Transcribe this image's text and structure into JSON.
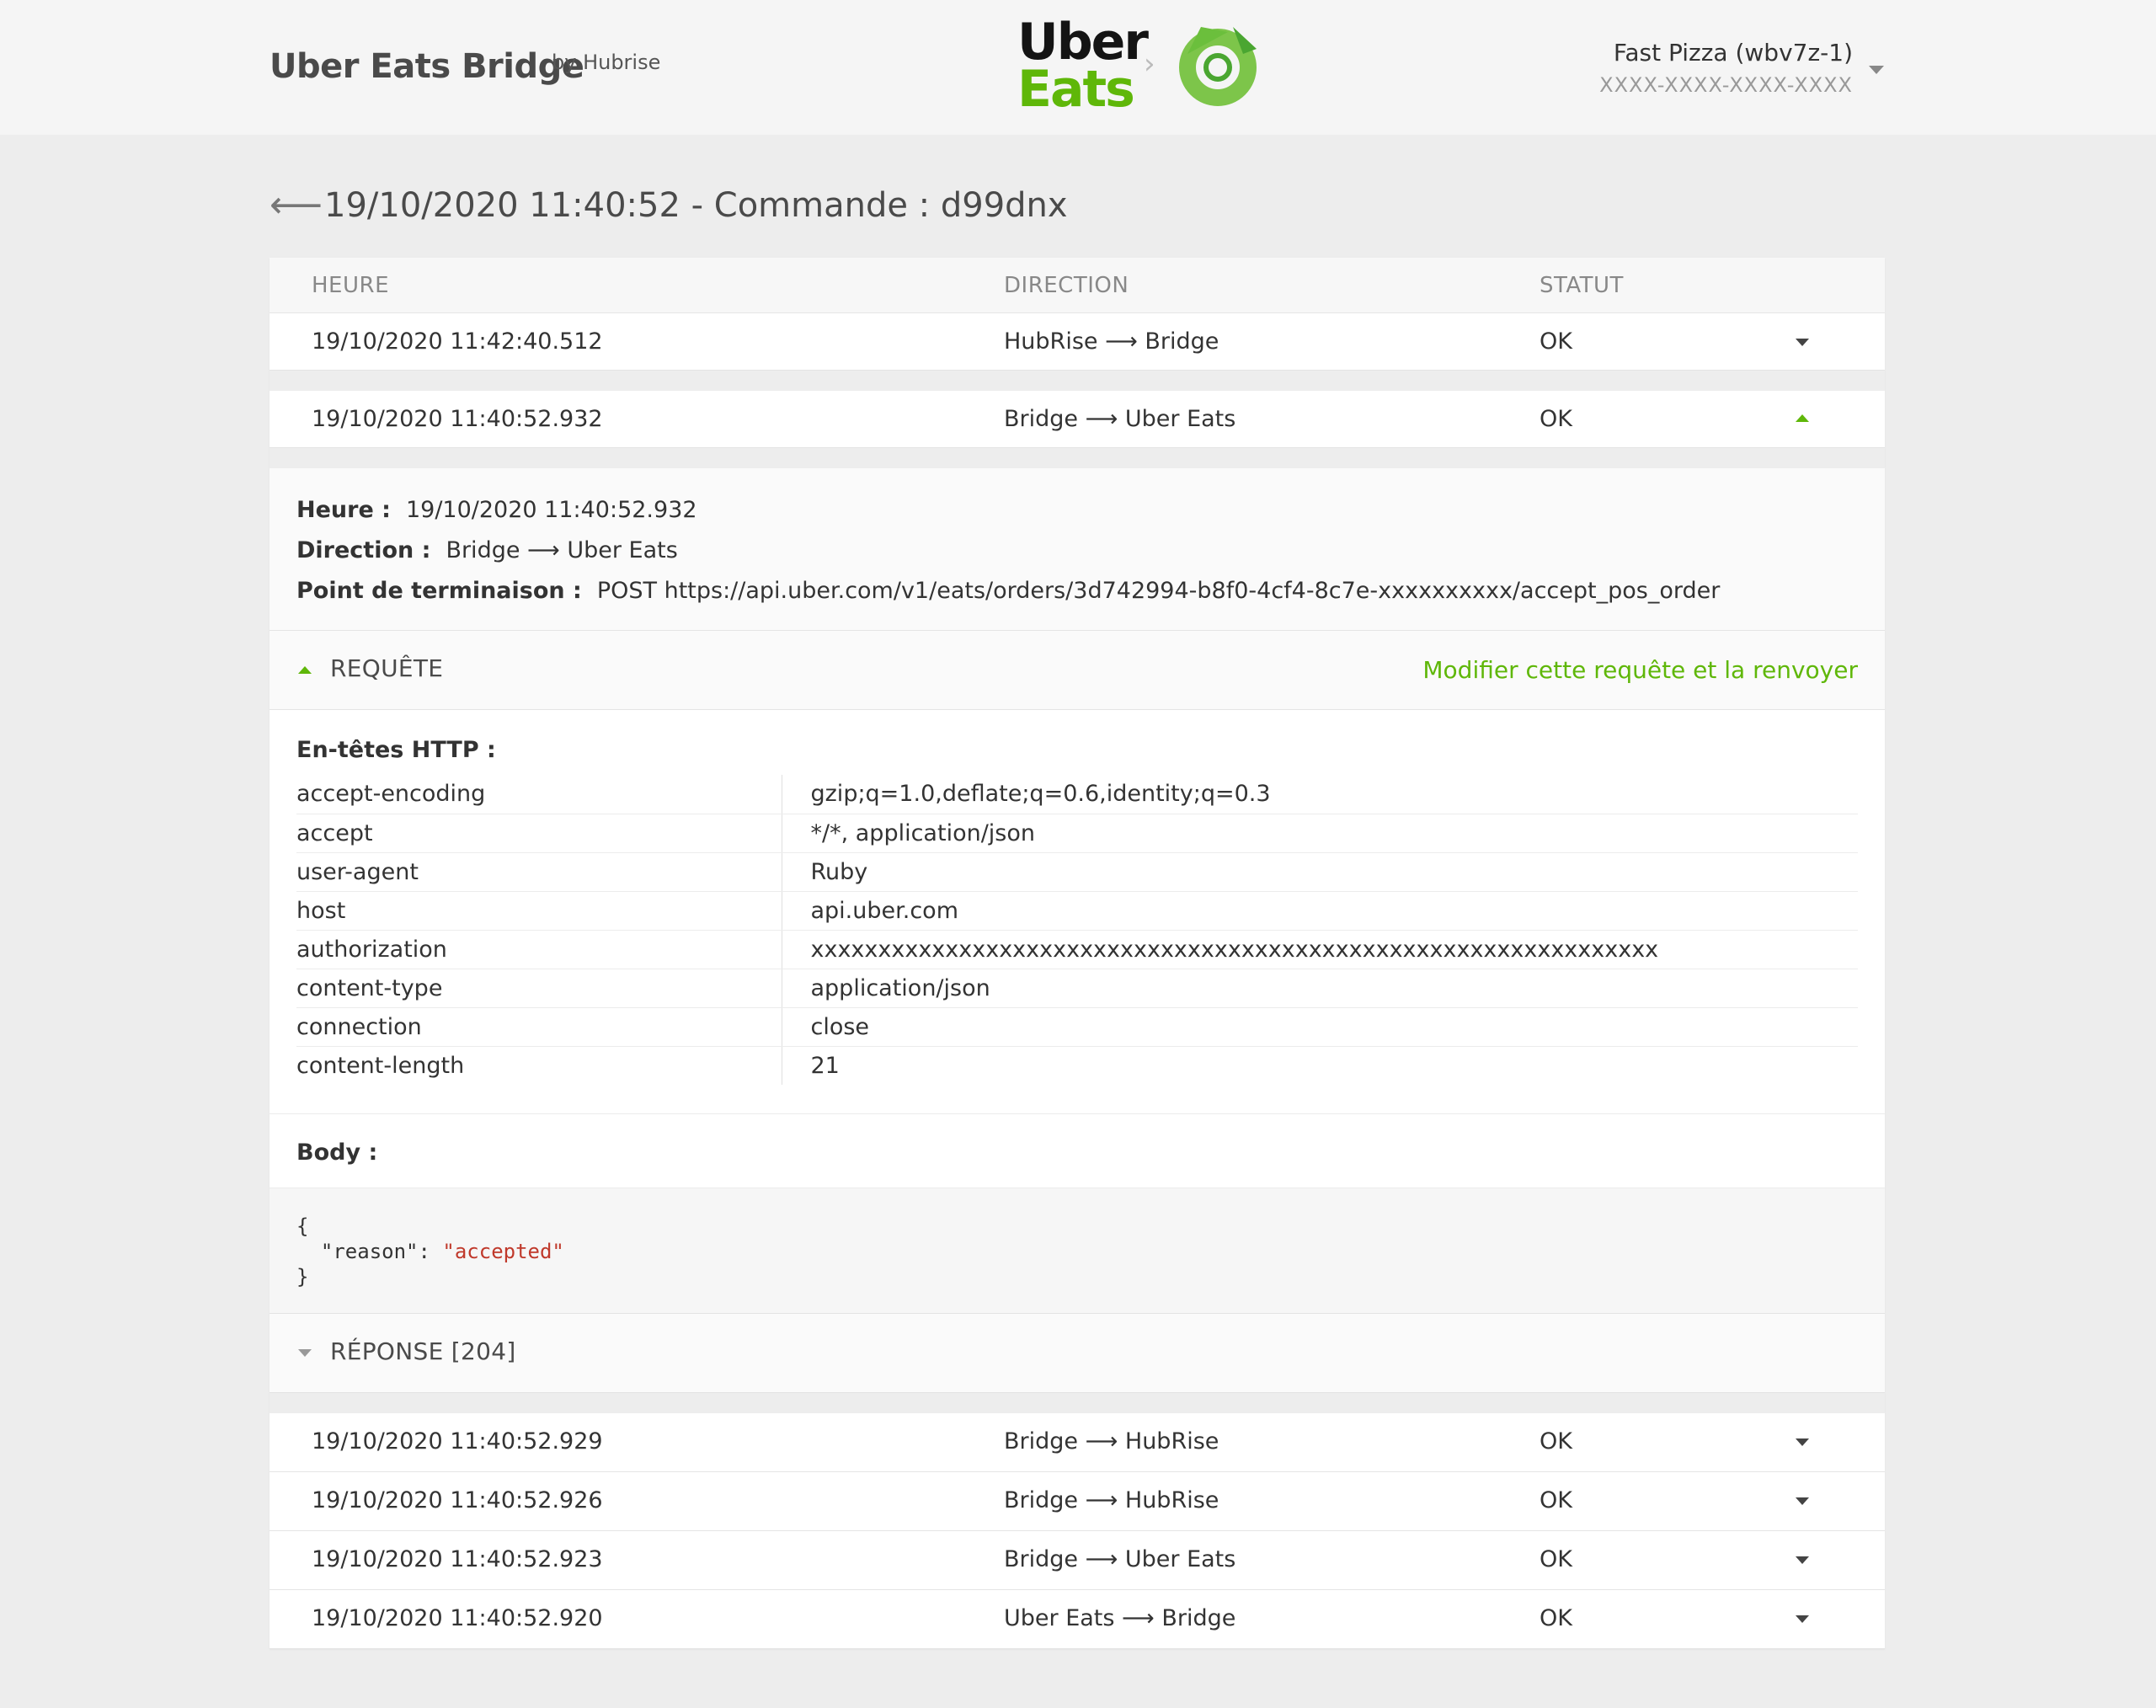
{
  "header": {
    "app_title": "Uber Eats Bridge",
    "app_by": "by Hubrise",
    "logo_line1": "Uber",
    "logo_line2": "Eats",
    "logo_chevron": "›",
    "account_name": "Fast Pizza (wbv7z-1)",
    "account_key": "XXXX-XXXX-XXXX-XXXX"
  },
  "page": {
    "back_symbol": "⟵",
    "title": "19/10/2020 11:40:52 - Commande : d99dnx"
  },
  "table": {
    "columns": {
      "time": "HEURE",
      "direction": "DIRECTION",
      "status": "STATUT"
    },
    "rows": [
      {
        "time": "19/10/2020 11:42:40.512",
        "direction": "HubRise ⟶ Bridge",
        "status": "OK",
        "expanded": false
      },
      {
        "time": "19/10/2020 11:40:52.932",
        "direction": "Bridge ⟶ Uber Eats",
        "status": "OK",
        "expanded": true
      },
      {
        "time": "19/10/2020 11:40:52.929",
        "direction": "Bridge ⟶ HubRise",
        "status": "OK",
        "expanded": false
      },
      {
        "time": "19/10/2020 11:40:52.926",
        "direction": "Bridge ⟶ HubRise",
        "status": "OK",
        "expanded": false
      },
      {
        "time": "19/10/2020 11:40:52.923",
        "direction": "Bridge ⟶ Uber Eats",
        "status": "OK",
        "expanded": false
      },
      {
        "time": "19/10/2020 11:40:52.920",
        "direction": "Uber Eats ⟶ Bridge",
        "status": "OK",
        "expanded": false
      }
    ]
  },
  "detail": {
    "time_label": "Heure :",
    "time_value": "19/10/2020 11:40:52.932",
    "direction_label": "Direction :",
    "direction_value": "Bridge ⟶ Uber Eats",
    "endpoint_label": "Point de terminaison :",
    "endpoint_value": "POST https://api.uber.com/v1/eats/orders/3d742994-b8f0-4cf4-8c7e-xxxxxxxxxx/accept_pos_order",
    "request_label": "REQUÊTE",
    "resend_link": "Modifier cette requête et la renvoyer",
    "headers_title": "En-têtes HTTP :",
    "headers": [
      {
        "key": "accept-encoding",
        "value": "gzip;q=1.0,deflate;q=0.6,identity;q=0.3"
      },
      {
        "key": "accept",
        "value": "*/*, application/json"
      },
      {
        "key": "user-agent",
        "value": "Ruby"
      },
      {
        "key": "host",
        "value": "api.uber.com"
      },
      {
        "key": "authorization",
        "value": "xxxxxxxxxxxxxxxxxxxxxxxxxxxxxxxxxxxxxxxxxxxxxxxxxxxxxxxxxxxxxxx"
      },
      {
        "key": "content-type",
        "value": "application/json"
      },
      {
        "key": "connection",
        "value": "close"
      },
      {
        "key": "content-length",
        "value": "21"
      }
    ],
    "body_title": "Body :",
    "body": {
      "open": "{",
      "key": "  \"reason\": ",
      "value": "\"accepted\"",
      "close": "}"
    },
    "response_label": "RÉPONSE [204]"
  },
  "colors": {
    "accent_green": "#5fb709",
    "background": "#ededed",
    "json_string": "#c0392b"
  },
  "icons": {
    "back": "arrow-left-icon",
    "row_toggle_closed": "caret-down-icon",
    "row_toggle_open": "caret-up-icon",
    "account_menu": "caret-down-icon"
  }
}
